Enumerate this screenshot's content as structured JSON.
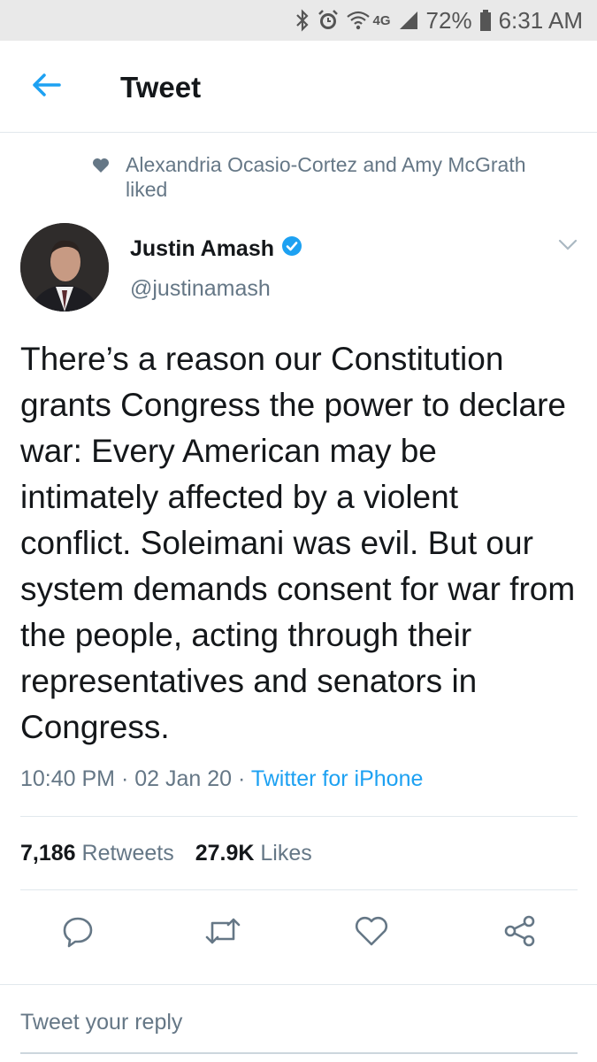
{
  "status_bar": {
    "network": "4G",
    "battery": "72%",
    "time": "6:31 AM",
    "icons": [
      "bluetooth-icon",
      "alarm-icon",
      "wifi-icon",
      "signal-icon",
      "battery-icon"
    ]
  },
  "header": {
    "title": "Tweet",
    "back_icon": "back-arrow-icon"
  },
  "social_context": {
    "text": "Alexandria Ocasio-Cortez and Amy McGrath liked",
    "icon": "heart-icon"
  },
  "tweet": {
    "author_name": "Justin Amash",
    "verified": true,
    "handle": "@justinamash",
    "text": "There’s a reason our Constitution grants Congress the power to declare war: Every American may be intimately affected by a violent conflict. Soleimani was evil. But our system demands consent for war from the people, acting through their representatives and senators in Congress.",
    "time": "10:40 PM",
    "date": "02 Jan 20",
    "source": "Twitter for iPhone",
    "retweets_count": "7,186",
    "retweets_label": "Retweets",
    "likes_count": "27.9K",
    "likes_label": "Likes"
  },
  "actions": [
    "reply-icon",
    "retweet-icon",
    "like-icon",
    "share-icon"
  ],
  "reply": {
    "placeholder": "Tweet your reply"
  },
  "colors": {
    "accent": "#1da1f2",
    "secondary_text": "#657786",
    "primary_text": "#14171a",
    "divider": "#e1e8ed"
  }
}
